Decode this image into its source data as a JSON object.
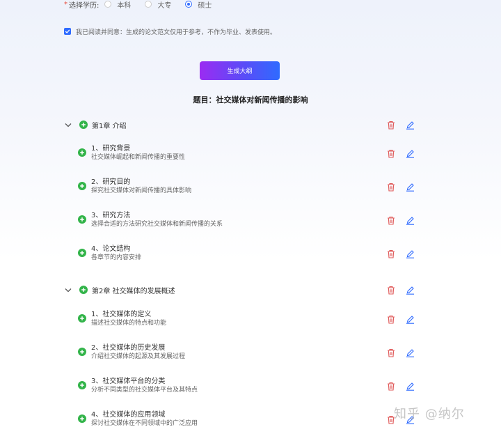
{
  "degree": {
    "required_mark": "*",
    "label": "选择学历:",
    "options": [
      "本科",
      "大专",
      "硕士"
    ],
    "selected": "硕士"
  },
  "agreement": {
    "checked": true,
    "text": "我已阅读并同意：生成的论文范文仅用于参考，不作为毕业、发表使用。"
  },
  "generate_button": "生成大纲",
  "title": "题目：社交媒体对新闻传播的影响",
  "chapters": [
    {
      "label": "第1章 介绍",
      "sections": [
        {
          "title": "1、研究背景",
          "desc": "社交媒体崛起和新闻传播的重要性"
        },
        {
          "title": "2、研究目的",
          "desc": "探究社交媒体对新闻传播的具体影响"
        },
        {
          "title": "3、研究方法",
          "desc": "选择合适的方法研究社交媒体和新闻传播的关系"
        },
        {
          "title": "4、论文结构",
          "desc": "各章节的内容安排"
        }
      ]
    },
    {
      "label": "第2章 社交媒体的发展概述",
      "sections": [
        {
          "title": "1、社交媒体的定义",
          "desc": "描述社交媒体的特点和功能"
        },
        {
          "title": "2、社交媒体的历史发展",
          "desc": "介绍社交媒体的起源及其发展过程"
        },
        {
          "title": "3、社交媒体平台的分类",
          "desc": "分析不同类型的社交媒体平台及其特点"
        },
        {
          "title": "4、社交媒体的应用领域",
          "desc": "探讨社交媒体在不同领域中的广泛应用"
        }
      ]
    }
  ],
  "watermark": "知乎 @纳尔",
  "colors": {
    "accent": "#2f6bff",
    "delete": "#e05a5a",
    "add": "#33b44a",
    "edit": "#2f6bff"
  },
  "icons": {
    "expand": "chevron-down-icon",
    "add": "plus-circle-icon",
    "delete": "trash-icon",
    "edit": "pencil-icon"
  }
}
